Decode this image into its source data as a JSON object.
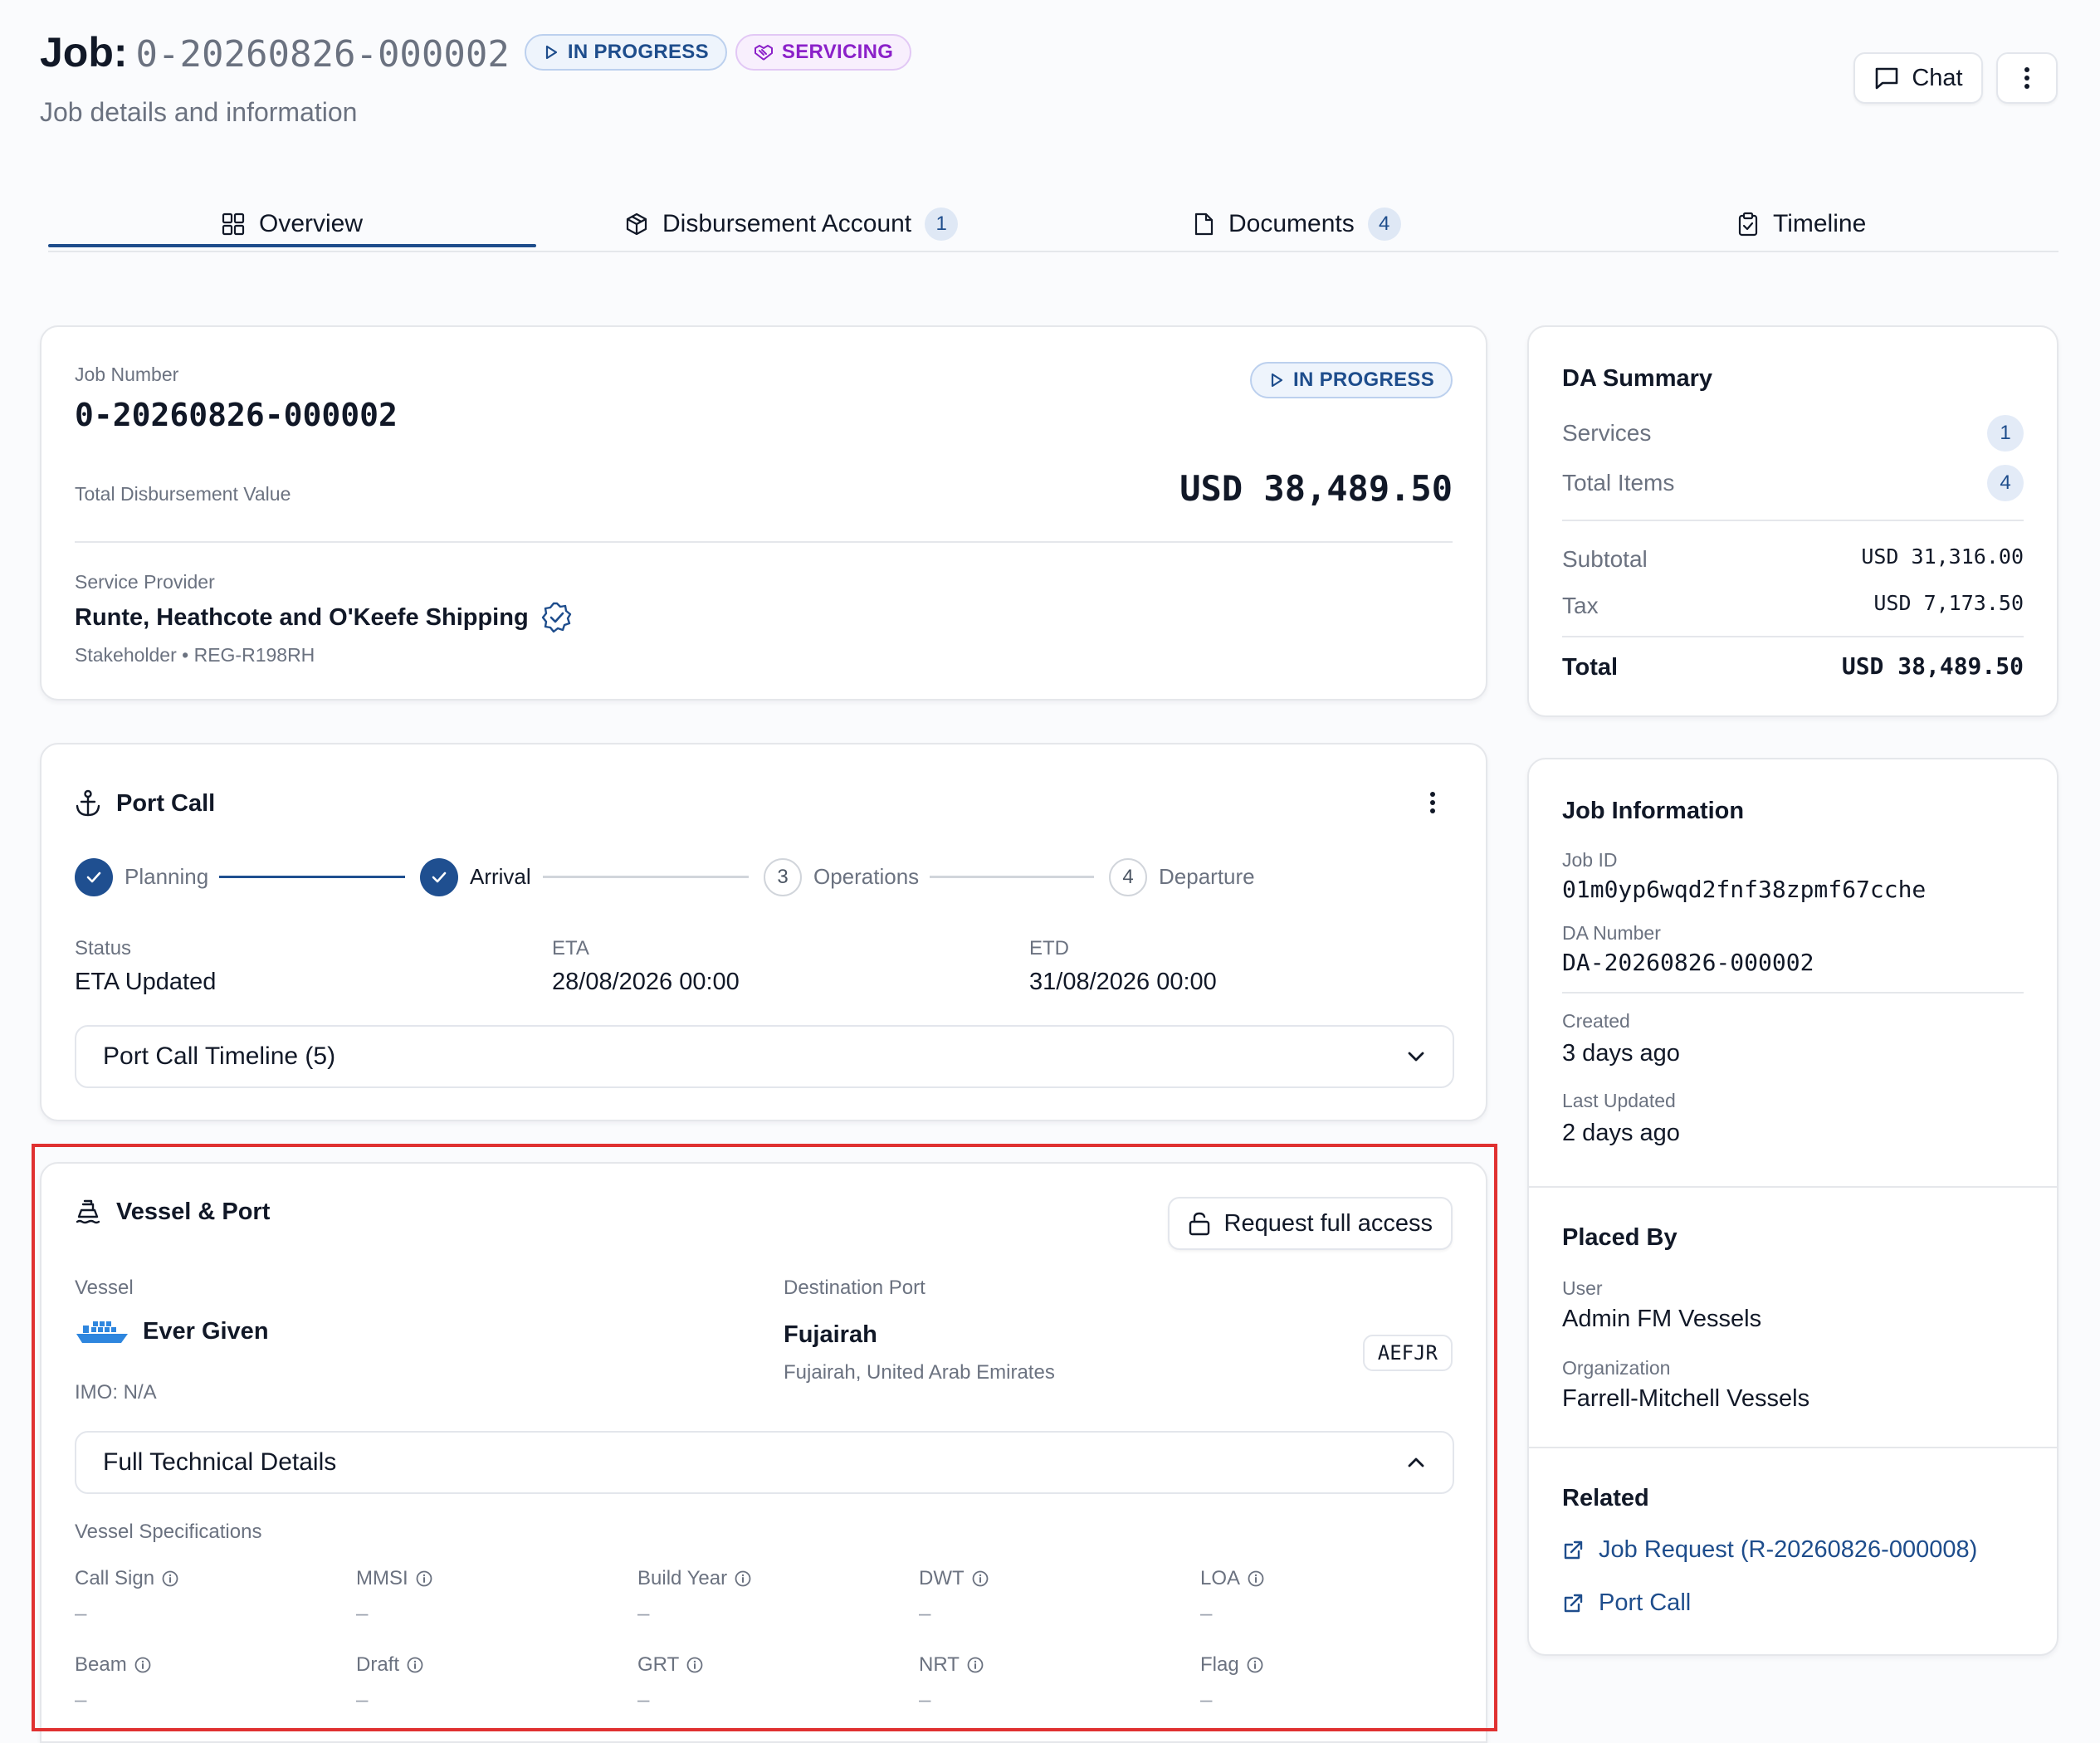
{
  "header": {
    "title_prefix": "Job:",
    "job_id": "0-20260826-000002",
    "status_badge": "IN PROGRESS",
    "type_badge": "SERVICING",
    "subtitle": "Job details and information",
    "chat_label": "Chat"
  },
  "tabs": [
    {
      "label": "Overview",
      "icon": "grid-icon"
    },
    {
      "label": "Disbursement Account",
      "icon": "box-icon",
      "count": "1"
    },
    {
      "label": "Documents",
      "icon": "file-icon",
      "count": "4"
    },
    {
      "label": "Timeline",
      "icon": "clipboard-icon"
    }
  ],
  "job_card": {
    "job_number_label": "Job Number",
    "job_number": "0-20260826-000002",
    "status": "IN PROGRESS",
    "total_label": "Total Disbursement Value",
    "total_value": "USD 38,489.50",
    "provider_label": "Service Provider",
    "provider_name": "Runte, Heathcote and O'Keefe Shipping",
    "provider_meta": "Stakeholder • REG-R198RH"
  },
  "port_call": {
    "title": "Port Call",
    "steps": [
      {
        "label": "Planning",
        "state": "done"
      },
      {
        "label": "Arrival",
        "state": "current"
      },
      {
        "label": "Operations",
        "state": "todo",
        "num": "3"
      },
      {
        "label": "Departure",
        "state": "todo",
        "num": "4"
      }
    ],
    "status_label": "Status",
    "status_value": "ETA Updated",
    "eta_label": "ETA",
    "eta_value": "28/08/2026 00:00",
    "etd_label": "ETD",
    "etd_value": "31/08/2026 00:00",
    "timeline_toggle": "Port Call Timeline (5)"
  },
  "vessel_port": {
    "title": "Vessel & Port",
    "request_access": "Request full access",
    "vessel_label": "Vessel",
    "vessel_name": "Ever Given",
    "imo": "IMO: N/A",
    "dest_label": "Destination Port",
    "dest_name": "Fujairah",
    "dest_location": "Fujairah, United Arab Emirates",
    "dest_code": "AEFJR",
    "tech_toggle": "Full Technical Details",
    "specs_heading": "Vessel Specifications",
    "specs": [
      {
        "label": "Call Sign",
        "value": "–"
      },
      {
        "label": "MMSI",
        "value": "–"
      },
      {
        "label": "Build Year",
        "value": "–"
      },
      {
        "label": "DWT",
        "value": "–"
      },
      {
        "label": "LOA",
        "value": "–"
      },
      {
        "label": "Beam",
        "value": "–"
      },
      {
        "label": "Draft",
        "value": "–"
      },
      {
        "label": "GRT",
        "value": "–"
      },
      {
        "label": "NRT",
        "value": "–"
      },
      {
        "label": "Flag",
        "value": "–"
      }
    ]
  },
  "da_summary": {
    "title": "DA Summary",
    "services_label": "Services",
    "services_count": "1",
    "items_label": "Total Items",
    "items_count": "4",
    "subtotal_label": "Subtotal",
    "subtotal_value": "USD 31,316.00",
    "tax_label": "Tax",
    "tax_value": "USD 7,173.50",
    "total_label": "Total",
    "total_value": "USD 38,489.50"
  },
  "job_info": {
    "title": "Job Information",
    "job_id_label": "Job ID",
    "job_id_value": "01m0yp6wqd2fnf38zpmf67cche",
    "da_number_label": "DA Number",
    "da_number_value": "DA-20260826-000002",
    "created_label": "Created",
    "created_value": "3 days ago",
    "updated_label": "Last Updated",
    "updated_value": "2 days ago"
  },
  "placed_by": {
    "title": "Placed By",
    "user_label": "User",
    "user_value": "Admin FM Vessels",
    "org_label": "Organization",
    "org_value": "Farrell-Mitchell Vessels"
  },
  "related": {
    "title": "Related",
    "links": [
      "Job Request (R-20260826-000008)",
      "Port Call"
    ]
  },
  "colors": {
    "accent": "#1e4d8c",
    "servicing": "#8b21c9",
    "highlight": "#e03131"
  }
}
